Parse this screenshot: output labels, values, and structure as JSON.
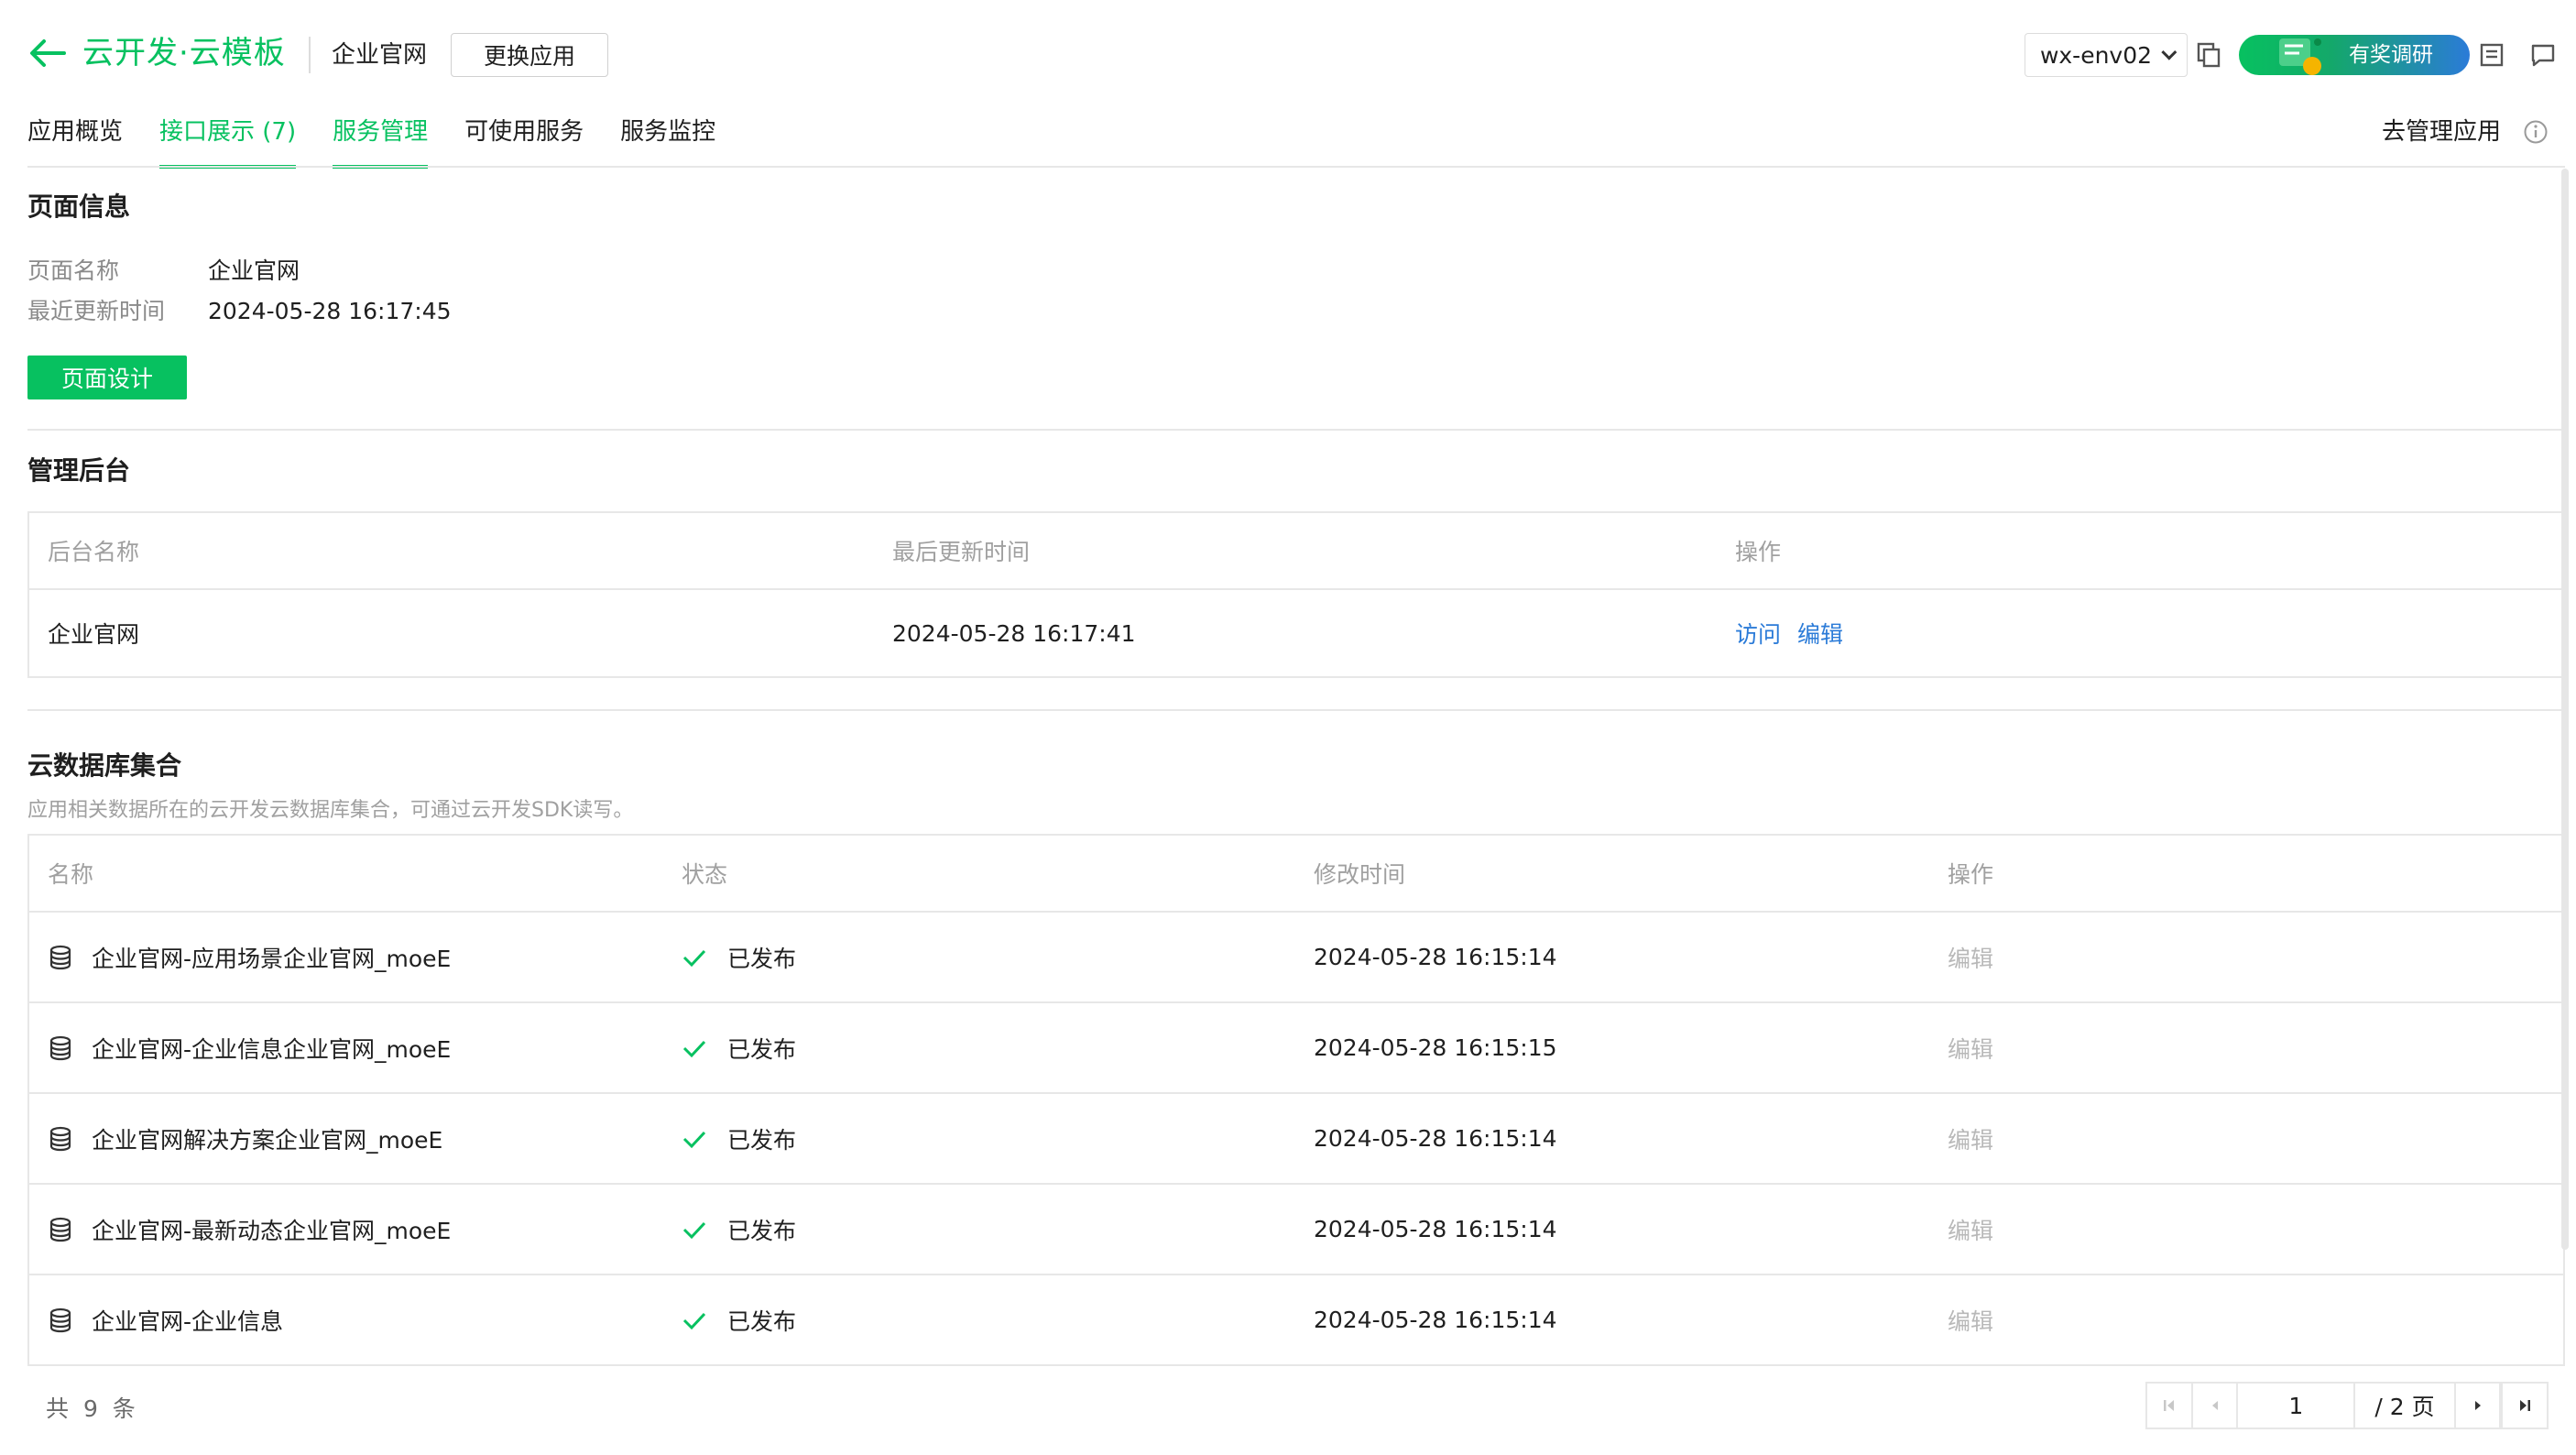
{
  "header": {
    "app_name": "云开发·云模板",
    "app_title": "企业官网",
    "switch_button": "更换应用",
    "env_selected": "wx-env02",
    "survey_label": "有奖调研",
    "manage_app": "去管理应用"
  },
  "tabs": [
    {
      "label": "应用概览",
      "active": false
    },
    {
      "label": "接口展示 (7)",
      "active": true
    },
    {
      "label": "服务管理",
      "active": true
    },
    {
      "label": "可使用服务",
      "active": false
    },
    {
      "label": "服务监控",
      "active": false
    }
  ],
  "page_info": {
    "title": "页面信息",
    "name_label": "页面名称",
    "name_value": "企业官网",
    "updated_label": "最近更新时间",
    "updated_value": "2024-05-28 16:17:45",
    "design_button": "页面设计"
  },
  "admin": {
    "title": "管理后台",
    "columns": [
      "后台名称",
      "最后更新时间",
      "操作"
    ],
    "rows": [
      {
        "name": "企业官网",
        "updated": "2024-05-28 16:17:41",
        "action_visit": "访问",
        "action_edit": "编辑"
      }
    ]
  },
  "database": {
    "title": "云数据库集合",
    "description": "应用相关数据所在的云开发云数据库集合，可通过云开发SDK读写。",
    "columns": [
      "名称",
      "状态",
      "修改时间",
      "操作"
    ],
    "rows": [
      {
        "name": "企业官网-应用场景企业官网_moeE",
        "status": "已发布",
        "modified": "2024-05-28 16:15:14",
        "action": "编辑"
      },
      {
        "name": "企业官网-企业信息企业官网_moeE",
        "status": "已发布",
        "modified": "2024-05-28 16:15:15",
        "action": "编辑"
      },
      {
        "name": "企业官网解决方案企业官网_moeE",
        "status": "已发布",
        "modified": "2024-05-28 16:15:14",
        "action": "编辑"
      },
      {
        "name": "企业官网-最新动态企业官网_moeE",
        "status": "已发布",
        "modified": "2024-05-28 16:15:14",
        "action": "编辑"
      },
      {
        "name": "企业官网-企业信息",
        "status": "已发布",
        "modified": "2024-05-28 16:15:14",
        "action": "编辑"
      }
    ]
  },
  "pagination": {
    "total_text": "共 9 条",
    "current_page": "1",
    "total_pages_text": "/ 2 页"
  },
  "colors": {
    "brand_green": "#07c160",
    "link_blue": "#2b7bd8",
    "muted_text": "#8a8a8a"
  },
  "icons": [
    "back-arrow-icon",
    "chevron-down-icon",
    "copy-icon",
    "survey-badge-icon",
    "document-icon",
    "message-icon",
    "info-icon",
    "database-icon",
    "check-icon",
    "first-page-icon",
    "prev-page-icon",
    "next-page-icon",
    "last-page-icon"
  ]
}
